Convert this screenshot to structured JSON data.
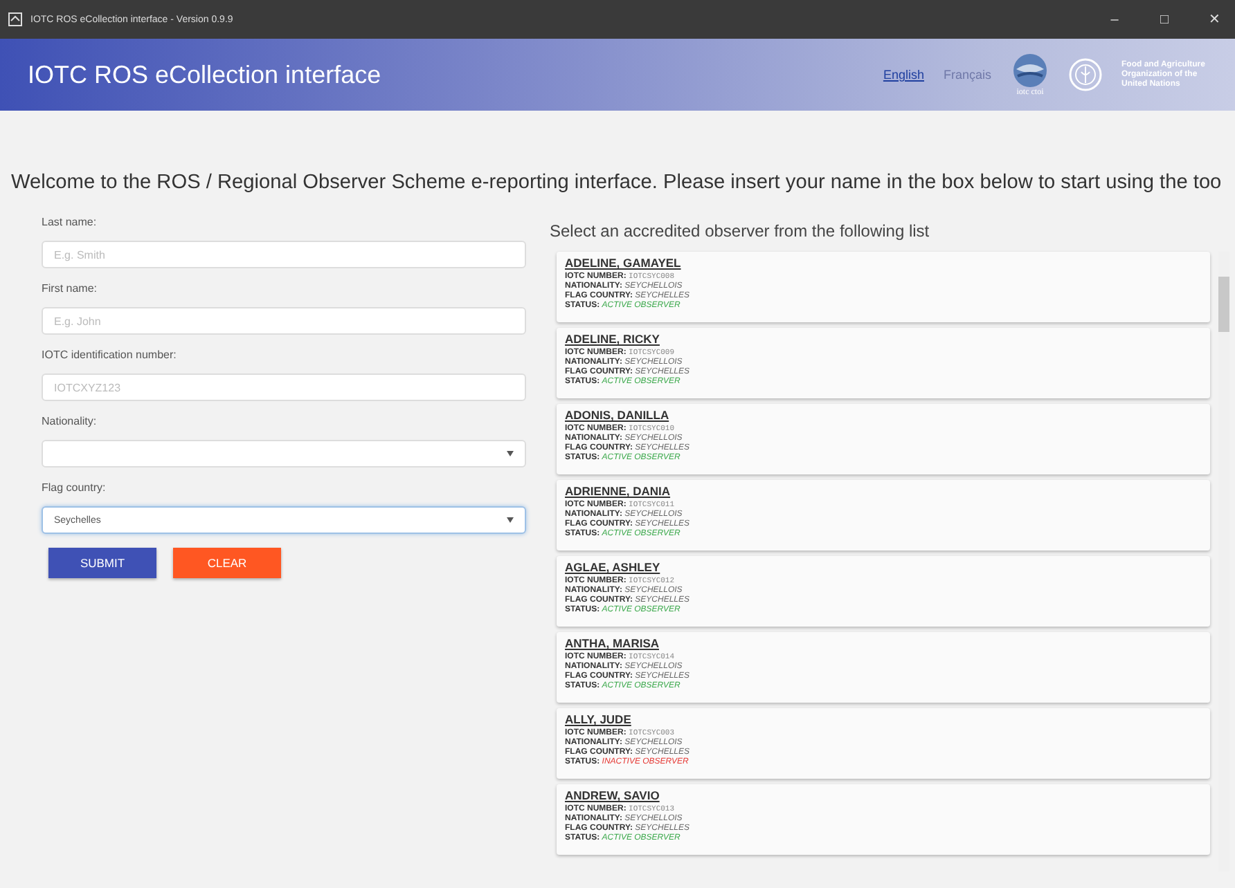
{
  "window": {
    "title": "IOTC ROS eCollection interface - Version 0.9.9",
    "controls": [
      "–",
      "□",
      "✕"
    ]
  },
  "header": {
    "title": "IOTC ROS eCollection interface",
    "languages": [
      {
        "label": "English",
        "selected": true
      },
      {
        "label": "Français",
        "selected": false
      }
    ],
    "iotc_logo_text": "iotc ctoi",
    "fao_logo_text": "Food and Agriculture Organization of the United Nations"
  },
  "welcome": "Welcome to the ROS / Regional Observer Scheme e-reporting interface. Please insert your name in the box below to start using the too",
  "form": {
    "fields": [
      {
        "kind": "text",
        "label": "Last name:",
        "placeholder": "E.g. Smith"
      },
      {
        "kind": "text",
        "label": "First name:",
        "placeholder": "E.g. John"
      },
      {
        "kind": "text",
        "label": "IOTC identification number:",
        "placeholder": "IOTCXYZ123"
      },
      {
        "kind": "select",
        "label": "Nationality:"
      },
      {
        "kind": "select",
        "label": "Flag country:",
        "value": "Seychelles"
      }
    ],
    "buttons": [
      {
        "label": "SUBMIT",
        "kind": "primary"
      },
      {
        "label": "CLEAR",
        "kind": "danger"
      }
    ]
  },
  "observers": {
    "heading": "Select an accredited observer from the following list",
    "items": [
      {
        "name": "ADELINE, GAMAYEL",
        "details": [
          {
            "kind": "code",
            "label": "IOTC NUMBER:",
            "value": "IOTCSYC008"
          },
          {
            "kind": "text",
            "label": "NATIONALITY:",
            "value": "SEYCHELLOIS"
          },
          {
            "kind": "text",
            "label": "FLAG COUNTRY:",
            "value": "SEYCHELLES"
          }
        ],
        "status_label": "STATUS:",
        "status": "ACTIVE OBSERVER",
        "active": true
      },
      {
        "name": "ADELINE, RICKY",
        "details": [
          {
            "kind": "code",
            "label": "IOTC NUMBER:",
            "value": "IOTCSYC009"
          },
          {
            "kind": "text",
            "label": "NATIONALITY:",
            "value": "SEYCHELLOIS"
          },
          {
            "kind": "text",
            "label": "FLAG COUNTRY:",
            "value": "SEYCHELLES"
          }
        ],
        "status_label": "STATUS:",
        "status": "ACTIVE OBSERVER",
        "active": true
      },
      {
        "name": "ADONIS, DANILLA",
        "details": [
          {
            "kind": "code",
            "label": "IOTC NUMBER:",
            "value": "IOTCSYC010"
          },
          {
            "kind": "text",
            "label": "NATIONALITY:",
            "value": "SEYCHELLOIS"
          },
          {
            "kind": "text",
            "label": "FLAG COUNTRY:",
            "value": "SEYCHELLES"
          }
        ],
        "status_label": "STATUS:",
        "status": "ACTIVE OBSERVER",
        "active": true
      },
      {
        "name": "ADRIENNE, DANIA",
        "details": [
          {
            "kind": "code",
            "label": "IOTC NUMBER:",
            "value": "IOTCSYC011"
          },
          {
            "kind": "text",
            "label": "NATIONALITY:",
            "value": "SEYCHELLOIS"
          },
          {
            "kind": "text",
            "label": "FLAG COUNTRY:",
            "value": "SEYCHELLES"
          }
        ],
        "status_label": "STATUS:",
        "status": "ACTIVE OBSERVER",
        "active": true
      },
      {
        "name": "AGLAE, ASHLEY",
        "details": [
          {
            "kind": "code",
            "label": "IOTC NUMBER:",
            "value": "IOTCSYC012"
          },
          {
            "kind": "text",
            "label": "NATIONALITY:",
            "value": "SEYCHELLOIS"
          },
          {
            "kind": "text",
            "label": "FLAG COUNTRY:",
            "value": "SEYCHELLES"
          }
        ],
        "status_label": "STATUS:",
        "status": "ACTIVE OBSERVER",
        "active": true
      },
      {
        "name": "ANTHA, MARISA",
        "details": [
          {
            "kind": "code",
            "label": "IOTC NUMBER:",
            "value": "IOTCSYC014"
          },
          {
            "kind": "text",
            "label": "NATIONALITY:",
            "value": "SEYCHELLOIS"
          },
          {
            "kind": "text",
            "label": "FLAG COUNTRY:",
            "value": "SEYCHELLES"
          }
        ],
        "status_label": "STATUS:",
        "status": "ACTIVE OBSERVER",
        "active": true
      },
      {
        "name": "ALLY, JUDE",
        "details": [
          {
            "kind": "code",
            "label": "IOTC NUMBER:",
            "value": "IOTCSYC003"
          },
          {
            "kind": "text",
            "label": "NATIONALITY:",
            "value": "SEYCHELLOIS"
          },
          {
            "kind": "text",
            "label": "FLAG COUNTRY:",
            "value": "SEYCHELLES"
          }
        ],
        "status_label": "STATUS:",
        "status": "INACTIVE OBSERVER",
        "active": false
      },
      {
        "name": "ANDREW, SAVIO",
        "details": [
          {
            "kind": "code",
            "label": "IOTC NUMBER:",
            "value": "IOTCSYC013"
          },
          {
            "kind": "text",
            "label": "NATIONALITY:",
            "value": "SEYCHELLOIS"
          },
          {
            "kind": "text",
            "label": "FLAG COUNTRY:",
            "value": "SEYCHELLES"
          }
        ],
        "status_label": "STATUS:",
        "status": "ACTIVE OBSERVER",
        "active": true
      }
    ]
  }
}
